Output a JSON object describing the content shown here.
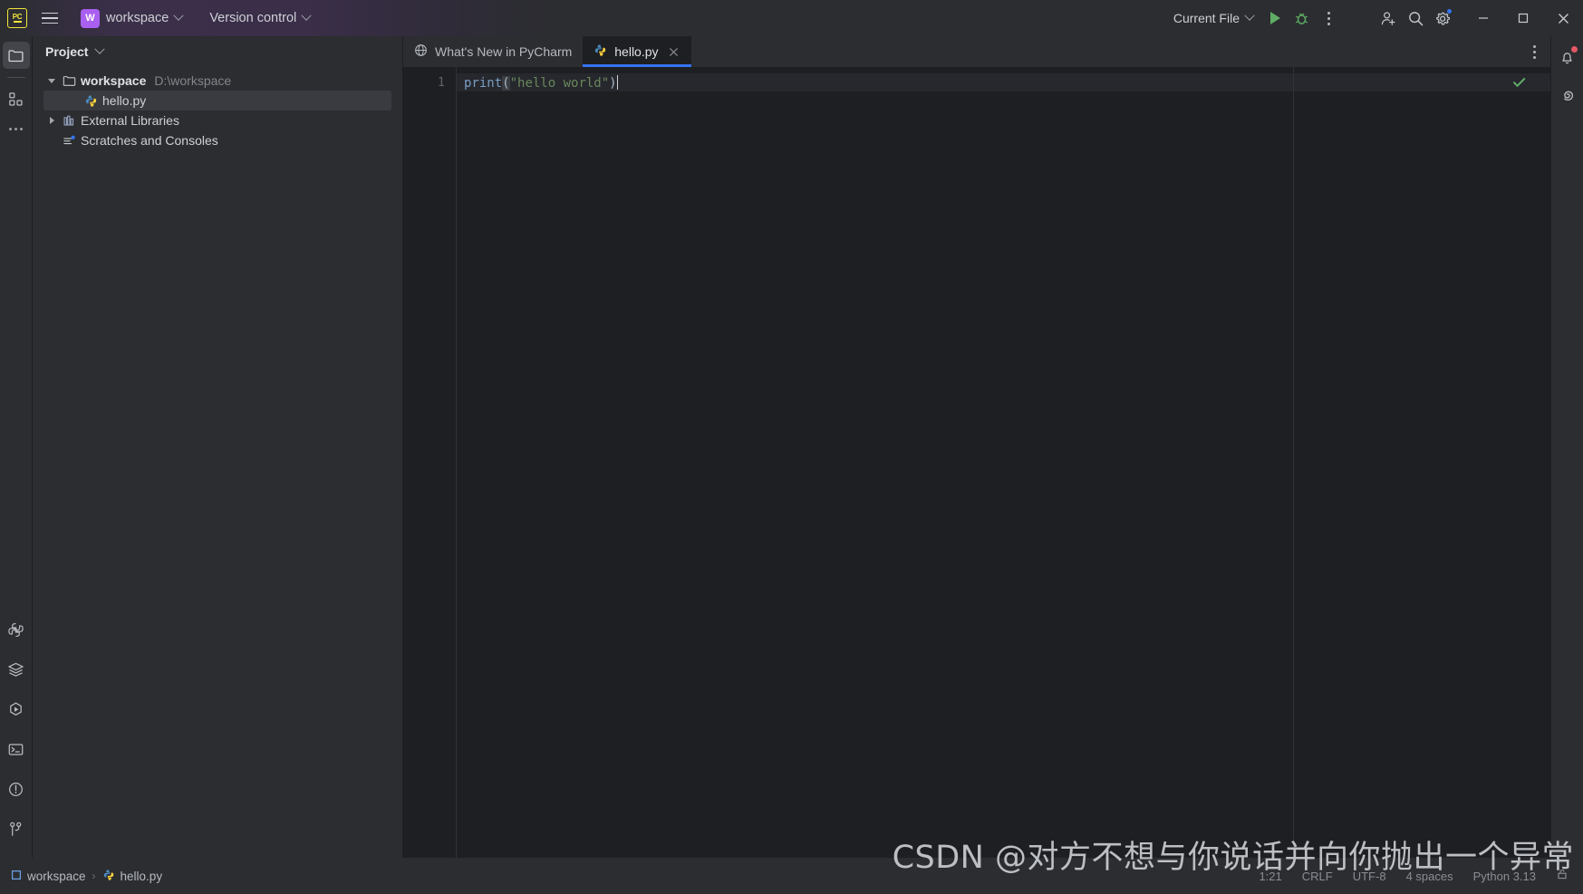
{
  "titlebar": {
    "app_logo": "pycharm-logo",
    "logo_text": "PC",
    "menu_icon": "hamburger-menu-icon",
    "project_badge": "W",
    "project_name": "workspace",
    "version_control_label": "Version control",
    "run_config_label": "Current File",
    "run_icon": "run-icon",
    "debug_icon": "debug-icon",
    "more_icon": "more-vertical-icon",
    "account_icon": "add-account-icon",
    "search_icon": "search-icon",
    "settings_icon": "settings-gear-icon",
    "minimize_icon": "minimize-icon",
    "maximize_icon": "maximize-icon",
    "close_icon": "close-icon",
    "accent_purple": "#a95ff0",
    "accent_yellow": "#f2e63a",
    "notification_blue": "#3574f0"
  },
  "left_rail": {
    "top_items": [
      {
        "name": "project-tool-icon",
        "label": "Project",
        "active": true
      },
      {
        "name": "structure-tool-icon",
        "label": "Structure",
        "active": false
      },
      {
        "name": "more-tools-icon",
        "label": "More tool windows",
        "active": false
      }
    ],
    "bottom_items": [
      {
        "name": "python-console-icon",
        "label": "Python Console"
      },
      {
        "name": "database-layers-icon",
        "label": "Database"
      },
      {
        "name": "run-tool-icon",
        "label": "Run"
      },
      {
        "name": "terminal-icon",
        "label": "Terminal"
      },
      {
        "name": "problems-icon",
        "label": "Problems"
      },
      {
        "name": "version-control-branch-icon",
        "label": "Version Control"
      }
    ]
  },
  "right_rail": {
    "items": [
      {
        "name": "notifications-bell-icon",
        "label": "Notifications",
        "badge": true,
        "badge_color": "#e55765"
      },
      {
        "name": "ai-assistant-icon",
        "label": "AI Assistant",
        "badge": false
      }
    ]
  },
  "project_panel": {
    "title": "Project",
    "chevron_icon": "chevron-down-icon",
    "tree": [
      {
        "name": "workspace",
        "path": "D:\\workspace",
        "icon": "folder-icon",
        "expanded": true,
        "toggle_icon": "chevron-down-icon",
        "level": 0,
        "selected": false,
        "bold": true
      },
      {
        "name": "hello.py",
        "path": "",
        "icon": "python-file-icon",
        "expanded": false,
        "toggle_icon": "",
        "level": 1,
        "selected": true,
        "bold": false
      },
      {
        "name": "External Libraries",
        "path": "",
        "icon": "library-icon",
        "expanded": false,
        "toggle_icon": "chevron-right-icon",
        "level": 0,
        "selected": false,
        "bold": false
      },
      {
        "name": "Scratches and Consoles",
        "path": "",
        "icon": "scratches-icon",
        "expanded": false,
        "toggle_icon": "",
        "level": 0,
        "selected": false,
        "bold": false
      }
    ]
  },
  "editor": {
    "tabs": [
      {
        "label": "What's New in PyCharm",
        "icon": "globe-icon",
        "active": false,
        "closable": false
      },
      {
        "label": "hello.py",
        "icon": "python-file-icon",
        "active": true,
        "closable": true
      }
    ],
    "tab_overflow_icon": "more-vertical-icon",
    "tab_close_icon": "close-icon",
    "active_tab_underline_color": "#3574f0",
    "lines": [
      {
        "number": "1",
        "tokens": [
          {
            "text": "print",
            "type": "function"
          },
          {
            "text": "(",
            "type": "paren"
          },
          {
            "text": "\"hello world\"",
            "type": "string"
          },
          {
            "text": ")",
            "type": "paren"
          }
        ]
      }
    ],
    "full_text": "print(\"hello world\")",
    "inspection_status_icon": "checkmark-icon",
    "inspection_status_color": "#5fad65"
  },
  "statusbar": {
    "breadcrumbs": [
      {
        "label": "workspace",
        "icon": "module-icon"
      },
      {
        "label": "hello.py",
        "icon": "python-file-icon"
      }
    ],
    "separator": "›",
    "items": [
      {
        "name": "caret-position",
        "label": "1:21"
      },
      {
        "name": "line-separator",
        "label": "CRLF"
      },
      {
        "name": "file-encoding",
        "label": "UTF-8"
      },
      {
        "name": "indent-size",
        "label": "4 spaces"
      },
      {
        "name": "python-interpreter",
        "label": "Python 3.13"
      }
    ],
    "lock_icon": "read-only-toggle-icon"
  },
  "watermark": {
    "text": "CSDN @对方不想与你说话并向你抛出一个异常"
  }
}
